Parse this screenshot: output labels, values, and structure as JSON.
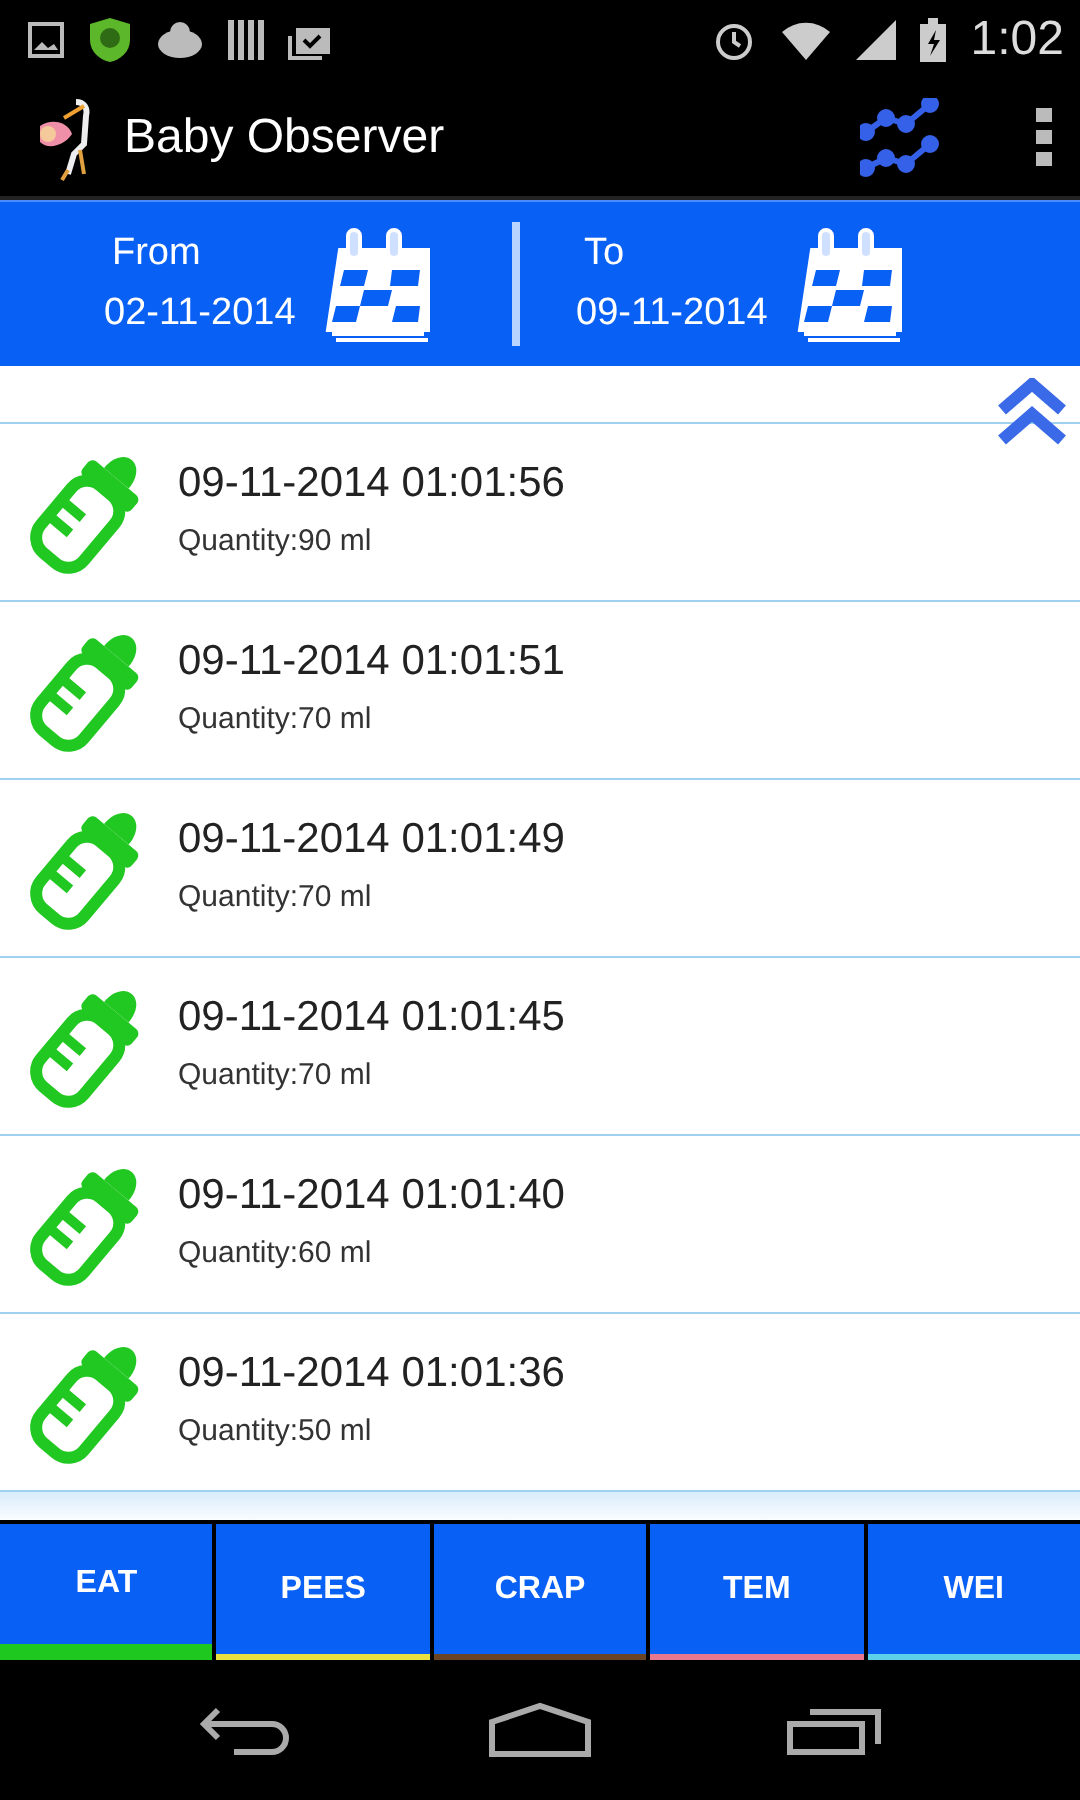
{
  "status_bar": {
    "time": "1:02"
  },
  "app_bar": {
    "title": "Baby Observer"
  },
  "date_range": {
    "from_label": "From",
    "from_date": "02-11-2014",
    "to_label": "To",
    "to_date": "09-11-2014"
  },
  "entries": [
    {
      "timestamp": "09-11-2014 01:01:56",
      "quantity": "Quantity:90 ml"
    },
    {
      "timestamp": "09-11-2014 01:01:51",
      "quantity": "Quantity:70 ml"
    },
    {
      "timestamp": "09-11-2014 01:01:49",
      "quantity": "Quantity:70 ml"
    },
    {
      "timestamp": "09-11-2014 01:01:45",
      "quantity": "Quantity:70 ml"
    },
    {
      "timestamp": "09-11-2014 01:01:40",
      "quantity": "Quantity:60 ml"
    },
    {
      "timestamp": "09-11-2014 01:01:36",
      "quantity": "Quantity:50 ml"
    }
  ],
  "tabs": [
    {
      "label": "EAT",
      "selected": true,
      "color": "#1ec81e"
    },
    {
      "label": "PEES",
      "selected": false,
      "color": "#e8e040"
    },
    {
      "label": "CRAP",
      "selected": false,
      "color": "#6b4423"
    },
    {
      "label": "TEM",
      "selected": false,
      "color": "#e87890"
    },
    {
      "label": "WEI",
      "selected": false,
      "color": "#5ed0e8"
    }
  ]
}
